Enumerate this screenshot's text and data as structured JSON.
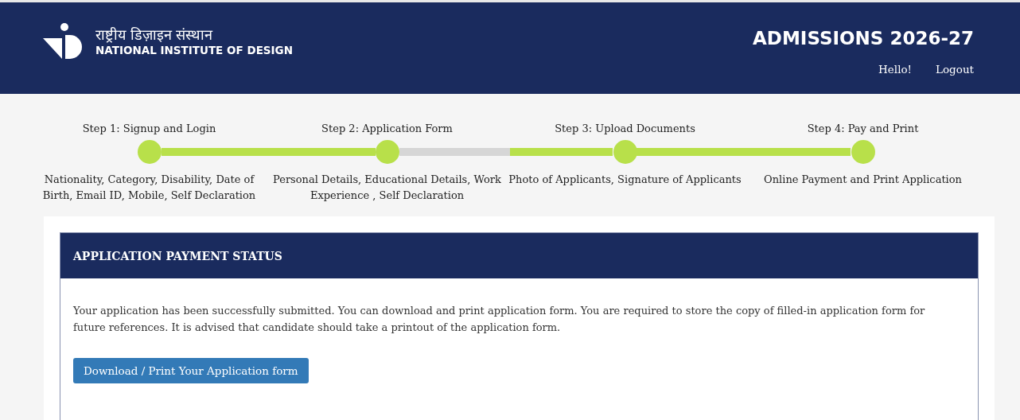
{
  "header": {
    "logo_hindi": "राष्ट्रीय डिज़ाइन संस्थान",
    "logo_english": "NATIONAL INSTITUTE OF DESIGN",
    "title": "ADMISSIONS 2026-27",
    "links": [
      "Hello!",
      "Logout"
    ]
  },
  "steps": [
    {
      "title": "Step 1: Signup and Login",
      "description": "Nationality, Category, Disability, Date of Birth, Email ID, Mobile, Self Declaration"
    },
    {
      "title": "Step 2: Application Form",
      "description": "Personal Details, Educational Details, Work Experience , Self Declaration"
    },
    {
      "title": "Step 3: Upload Documents",
      "description": "Photo of Applicants, Signature of Applicants"
    },
    {
      "title": "Step 4: Pay and Print",
      "description": "Online Payment and Print Application"
    }
  ],
  "connectors": [
    {
      "level": 1
    },
    {
      "level": 0.48
    },
    {
      "level": 1
    }
  ],
  "panel": {
    "title": "APPLICATION PAYMENT STATUS",
    "message": "Your application has been successfully submitted. You can download and print application form. You are required to store the copy of filled-in application form for future references. It is advised that candidate should take a printout of the application form.",
    "button": "Download / Print Your Application form"
  }
}
